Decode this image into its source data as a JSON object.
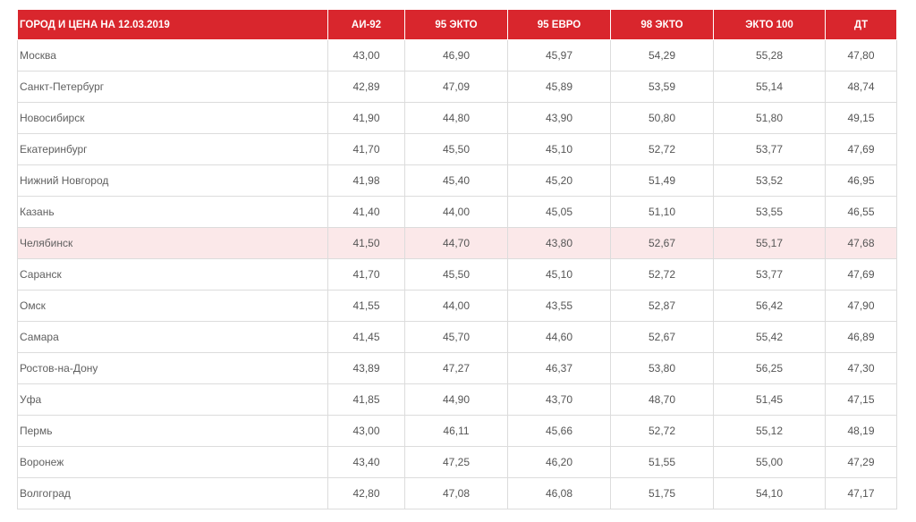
{
  "table": {
    "headers": [
      "ГОРОД И ЦЕНА НА 12.03.2019",
      "АИ-92",
      "95 ЭКТО",
      "95 ЕВРО",
      "98 ЭКТО",
      "ЭКТО 100",
      "ДТ"
    ],
    "rows": [
      [
        "Москва",
        "43,00",
        "46,90",
        "45,97",
        "54,29",
        "55,28",
        "47,80"
      ],
      [
        "Санкт-Петербург",
        "42,89",
        "47,09",
        "45,89",
        "53,59",
        "55,14",
        "48,74"
      ],
      [
        "Новосибирск",
        "41,90",
        "44,80",
        "43,90",
        "50,80",
        "51,80",
        "49,15"
      ],
      [
        "Екатеринбург",
        "41,70",
        "45,50",
        "45,10",
        "52,72",
        "53,77",
        "47,69"
      ],
      [
        "Нижний Новгород",
        "41,98",
        "45,40",
        "45,20",
        "51,49",
        "53,52",
        "46,95"
      ],
      [
        "Казань",
        "41,40",
        "44,00",
        "45,05",
        "51,10",
        "53,55",
        "46,55"
      ],
      [
        "Челябинск",
        "41,50",
        "44,70",
        "43,80",
        "52,67",
        "55,17",
        "47,68"
      ],
      [
        "Саранск",
        "41,70",
        "45,50",
        "45,10",
        "52,72",
        "53,77",
        "47,69"
      ],
      [
        "Омск",
        "41,55",
        "44,00",
        "43,55",
        "52,87",
        "56,42",
        "47,90"
      ],
      [
        "Самара",
        "41,45",
        "45,70",
        "44,60",
        "52,67",
        "55,42",
        "46,89"
      ],
      [
        "Ростов-на-Дону",
        "43,89",
        "47,27",
        "46,37",
        "53,80",
        "56,25",
        "47,30"
      ],
      [
        "Уфа",
        "41,85",
        "44,90",
        "43,70",
        "48,70",
        "51,45",
        "47,15"
      ],
      [
        "Пермь",
        "43,00",
        "46,11",
        "45,66",
        "52,72",
        "55,12",
        "48,19"
      ],
      [
        "Воронеж",
        "43,40",
        "47,25",
        "46,20",
        "51,55",
        "55,00",
        "47,29"
      ],
      [
        "Волгоград",
        "42,80",
        "47,08",
        "46,08",
        "51,75",
        "54,10",
        "47,17"
      ]
    ]
  },
  "colors": {
    "header_bg": "#d9262d",
    "header_text": "#ffffff",
    "highlight_row_bg": "#fbe8e9",
    "cell_text": "#555555",
    "grid_line": "#dcdcdc"
  }
}
